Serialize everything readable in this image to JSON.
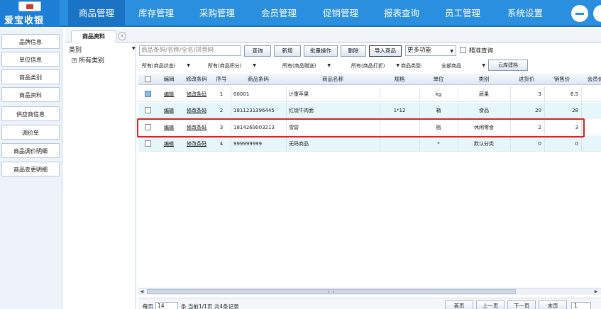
{
  "app": {
    "logo_text": "爱宝收银"
  },
  "nav": {
    "items": [
      {
        "label": "商品管理",
        "active": true
      },
      {
        "label": "库存管理"
      },
      {
        "label": "采购管理"
      },
      {
        "label": "会员管理"
      },
      {
        "label": "促销管理"
      },
      {
        "label": "报表查询"
      },
      {
        "label": "员工管理"
      },
      {
        "label": "系统设置"
      }
    ]
  },
  "sidebar": {
    "items": [
      {
        "label": "品牌信息"
      },
      {
        "label": "单位信息"
      },
      {
        "label": "商品类别"
      },
      {
        "label": "商品资料"
      },
      {
        "label": "供应商信息"
      },
      {
        "label": "调价单"
      },
      {
        "label": "商品调价明细"
      },
      {
        "label": "商品变更明细"
      }
    ]
  },
  "tabs": [
    {
      "label": "商品资料",
      "active": true
    }
  ],
  "category": {
    "label": "类别",
    "root": "所有类别"
  },
  "toolbar": {
    "search_placeholder": "商品条码/名称/全名/拼音码",
    "buttons": [
      "查询",
      "新增",
      "批量操作",
      "删除",
      "导入商品"
    ],
    "more_label": "更多功能",
    "exact_label": "精准查询"
  },
  "filters": {
    "status": "所有(商品状态)",
    "points": "所有(商品积分)",
    "gift": "所有(商品赠送)",
    "discount": "所有(商品打折)",
    "type_label": "商品类型:",
    "type_value": "全部商品",
    "cloud_button": "云库建档"
  },
  "grid": {
    "headers": [
      "编辑",
      "修改条码",
      "序号",
      "商品条码",
      "商品名称",
      "规格",
      "单位",
      "类别",
      "进货价",
      "销售价",
      "会员价"
    ],
    "rows": [
      {
        "edit": "编辑",
        "modify": "修改条码",
        "seq": "1",
        "barcode": "00001",
        "name": "计重苹果",
        "spec": "",
        "unit": "kg",
        "category": "蔬果",
        "cost": "3",
        "price": "6.5",
        "selected": true
      },
      {
        "edit": "编辑",
        "modify": "修改条码",
        "seq": "2",
        "barcode": "1811231396445",
        "name": "红烧牛肉面",
        "spec": "1*12",
        "unit": "箱",
        "category": "食品",
        "cost": "20",
        "price": "28"
      },
      {
        "edit": "编辑",
        "modify": "修改条码",
        "seq": "3",
        "barcode": "1814269003213",
        "name": "雪碧",
        "spec": "",
        "unit": "瓶",
        "category": "休闲零食",
        "cost": "2",
        "price": "3"
      },
      {
        "edit": "编辑",
        "modify": "修改条码",
        "seq": "4",
        "barcode": "999999999",
        "name": "无码商品",
        "spec": "",
        "unit": "*",
        "category": "默认分类",
        "cost": "0",
        "price": "0"
      }
    ]
  },
  "pager": {
    "per_page_label": "每页",
    "per_page_value": "14",
    "info": "条 当前1/1页 共4条记录",
    "buttons": [
      "首页",
      "上一页",
      "下一页",
      "末页"
    ],
    "page_value": "1"
  }
}
